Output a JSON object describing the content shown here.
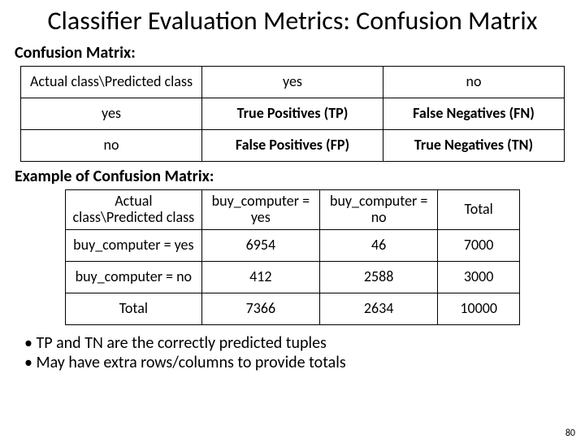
{
  "title": "Classifier Evaluation Metrics: Confusion Matrix",
  "sub1": "Confusion Matrix:",
  "sub2": "Example of Confusion Matrix:",
  "t1": {
    "r0": {
      "c0": "Actual class\\Predicted class",
      "c1": "yes",
      "c2": "no"
    },
    "r1": {
      "c0": "yes",
      "c1": "True Positives (TP)",
      "c2": "False Negatives (FN)"
    },
    "r2": {
      "c0": "no",
      "c1": "False Positives (FP)",
      "c2": "True Negatives (TN)"
    }
  },
  "t2": {
    "r0": {
      "c0": "Actual class\\Predicted class",
      "c1": "buy_computer = yes",
      "c2": "buy_computer = no",
      "c3": "Total"
    },
    "r1": {
      "c0": "buy_computer = yes",
      "c1": "6954",
      "c2": "46",
      "c3": "7000"
    },
    "r2": {
      "c0": "buy_computer = no",
      "c1": "412",
      "c2": "2588",
      "c3": "3000"
    },
    "r3": {
      "c0": "Total",
      "c1": "7366",
      "c2": "2634",
      "c3": "10000"
    }
  },
  "bullets": {
    "b0": "TP and TN are the correctly predicted tuples",
    "b1": "May have extra rows/columns to provide totals"
  },
  "page": "80",
  "chart_data": [
    {
      "type": "table",
      "title": "Confusion Matrix (definition)",
      "row_labels": [
        "yes",
        "no"
      ],
      "col_labels": [
        "yes",
        "no"
      ],
      "cells": [
        [
          "True Positives (TP)",
          "False Negatives (FN)"
        ],
        [
          "False Positives (FP)",
          "True Negatives (TN)"
        ]
      ]
    },
    {
      "type": "table",
      "title": "Example of Confusion Matrix",
      "row_labels": [
        "buy_computer = yes",
        "buy_computer = no",
        "Total"
      ],
      "col_labels": [
        "buy_computer = yes",
        "buy_computer = no",
        "Total"
      ],
      "cells": [
        [
          6954,
          46,
          7000
        ],
        [
          412,
          2588,
          3000
        ],
        [
          7366,
          2634,
          10000
        ]
      ]
    }
  ]
}
